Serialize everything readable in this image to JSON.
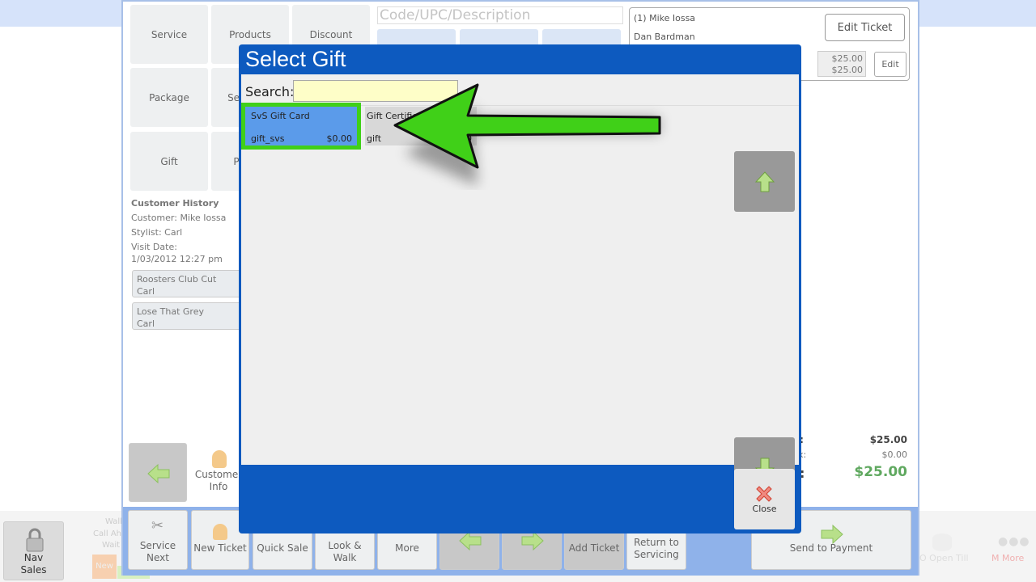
{
  "left_tiles": [
    {
      "label": "Service"
    },
    {
      "label": "Products"
    },
    {
      "label": "Discount"
    },
    {
      "label": "Package"
    },
    {
      "label": "Ser"
    },
    {
      "label": "Gift"
    },
    {
      "label": "P"
    }
  ],
  "search": {
    "placeholder": "Code/UPC/Description"
  },
  "ticket": {
    "customer_line": "(1) Mike Iossa",
    "stylist_line": "Dan Bardman",
    "edit_ticket_label": "Edit Ticket",
    "price_1": "$25.00",
    "price_2": "$25.00",
    "edit_label": "Edit"
  },
  "history": {
    "title": "Customer History",
    "customer": "Customer: Mike Iossa",
    "stylist": "Stylist: Carl",
    "visit_label": "Visit Date:",
    "visit_date": "1/03/2012 12:27 pm",
    "items": [
      {
        "name": "Roosters Club Cut",
        "stylist": "Carl"
      },
      {
        "name": "Lose That Grey",
        "stylist": "Carl"
      }
    ]
  },
  "totals": {
    "subtotal_value": "$25.00",
    "tax_value": "$0.00",
    "total_value": "$25.00",
    "label_1": "l:",
    "label_2": "x:",
    "label_3": ":"
  },
  "customer_info": {
    "label_1": "Customer",
    "label_2": "Info"
  },
  "bottom_nav": {
    "service_next_1": "Service",
    "service_next_2": "Next",
    "new_ticket": "New Ticket",
    "quick_sale": "Quick Sale",
    "look_walk_1": "Look &",
    "look_walk_2": "Walk",
    "more": "More",
    "add_ticket": "Add Ticket",
    "return_1": "Return to",
    "return_2": "Servicing",
    "send_to_payment": "Send to Payment"
  },
  "side_nav": {
    "nav_1": "Nav",
    "nav_2": "Sales",
    "walk": "Walk",
    "call_ahead": "Call Ahe",
    "wait": "Wait",
    "open_till": "O Open Till",
    "more": "M More",
    "new_label": "New"
  },
  "modal": {
    "title": "Select Gift",
    "search_label": "Search:",
    "search_value": "",
    "items": [
      {
        "name": "SvS Gift Card",
        "code": "gift_svs",
        "price": "$0.00"
      },
      {
        "name": "Gift Certificat",
        "code": "gift",
        "price": "00"
      }
    ],
    "close_label": "Close"
  },
  "colors": {
    "modal_blue": "#0d5abf",
    "selected_item": "#5b9bea",
    "highlight_green": "#40d018",
    "total_green": "#5fa85f"
  }
}
